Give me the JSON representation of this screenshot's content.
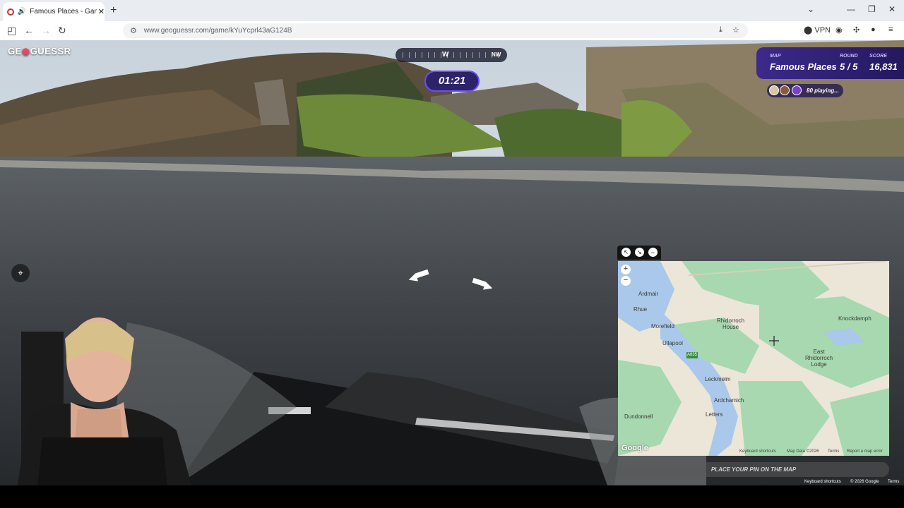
{
  "browser": {
    "tab_title": "Famous Places - Game - Ge",
    "tab_close": "✕",
    "new_tab": "+",
    "url": "www.geoguessr.com/game/kYuYcprl43aG124B",
    "vpn_label": "VPN"
  },
  "game": {
    "logo_prefix": "GE",
    "logo_pin": "◉",
    "logo_suffix": "GUESSR",
    "compass": {
      "w": "W",
      "nw": "NW"
    },
    "timer": "01:21",
    "status": {
      "map_label": "MAP",
      "map_value": "Famous Places",
      "round_label": "ROUND",
      "round_value": "5 / 5",
      "score_label": "SCORE",
      "score_value": "16,831"
    },
    "players_playing": "80 playing...",
    "place_pin_label": "PLACE YOUR PIN ON THE MAP"
  },
  "map": {
    "places": {
      "ardmair": "Ardmair",
      "rhue": "Rhue",
      "morefield": "Morefield",
      "ullapool": "Ullapool",
      "rhidorroch_house": "Rhidorroch\nHouse",
      "knockdamph": "Knockdamph",
      "east_rhidorroch": "East\nRhidorroch\nLodge",
      "leckmelm": "Leckmelm",
      "ardchamich": "Ardchamich",
      "dundonnell": "Dundonnell",
      "letters": "Letters",
      "road": "A835"
    },
    "zoom_in": "+",
    "zoom_out": "−",
    "google": "Google",
    "footer": {
      "shortcuts": "Keyboard shortcuts",
      "data": "Map Data ©2026",
      "terms": "Terms",
      "report": "Report a map error"
    }
  },
  "page_footer": {
    "shortcuts": "Keyboard shortcuts",
    "copyright": "© 2026 Google",
    "terms": "Terms"
  },
  "colors": {
    "accent": "#6b4cff",
    "logo_pin": "#e34a67",
    "map_water": "#9cc0e8",
    "map_forest": "#9fd6a8"
  }
}
